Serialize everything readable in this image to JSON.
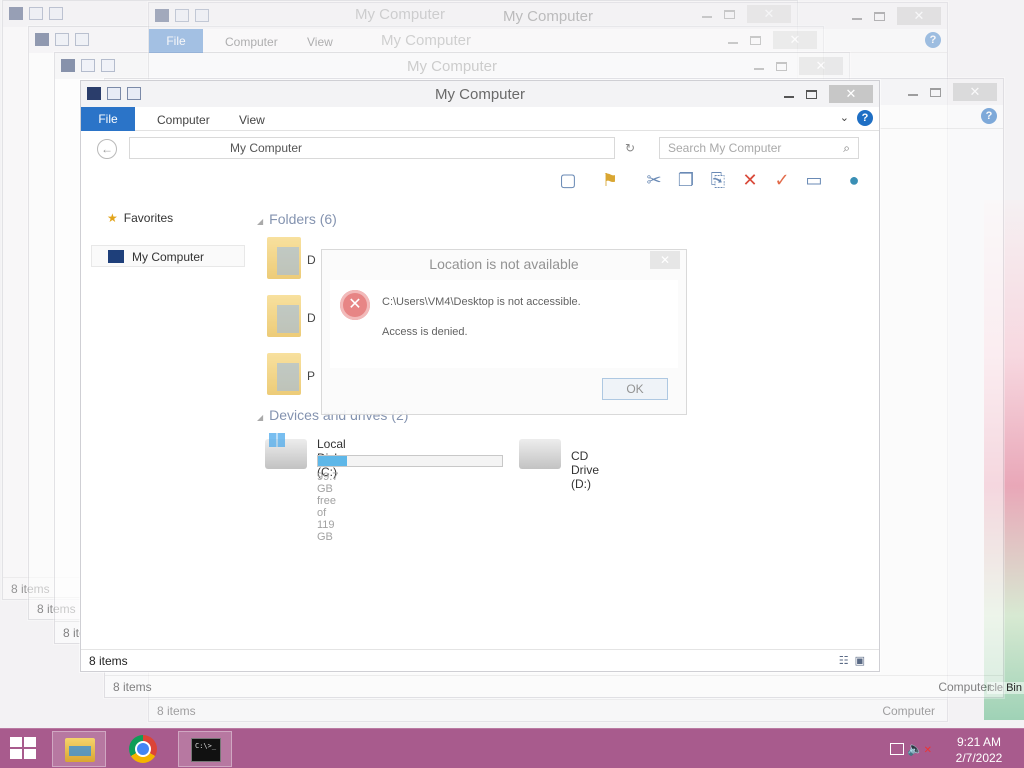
{
  "window": {
    "title": "My Computer",
    "tabs": {
      "file": "File",
      "computer": "Computer",
      "view": "View"
    },
    "close_glyph": "✕",
    "help_glyph": "?"
  },
  "address": {
    "path": "My Computer",
    "search_placeholder": "Search My Computer"
  },
  "nav_pane": {
    "favorites": "Favorites",
    "my_computer": "My Computer"
  },
  "content": {
    "folders_header": "Folders (6)",
    "folders": [
      "D",
      "D",
      "P"
    ],
    "devices_header": "Devices and drives (2)",
    "drives": [
      {
        "name": "Local Disk (C:)",
        "free": "99.7 GB free of 119 GB",
        "used_fraction": 0.16
      },
      {
        "name": "CD Drive (D:)"
      }
    ]
  },
  "status": {
    "items": "8 items",
    "computer": "Computer"
  },
  "dialog": {
    "title": "Location is not available",
    "message": "C:\\Users\\VM4\\Desktop is not accessible.",
    "detail": "Access is denied.",
    "ok": "OK",
    "close_glyph": "✕"
  },
  "desktop": {
    "recycle_bin": "cle Bin"
  },
  "taskbar": {
    "time": "9:21 AM",
    "date": "2/7/2022",
    "cmd_text": "C:\\>_"
  },
  "colors": {
    "file_tab": "#2b74c8",
    "taskbar": "#a85b8d",
    "error": "#e57b7b"
  }
}
